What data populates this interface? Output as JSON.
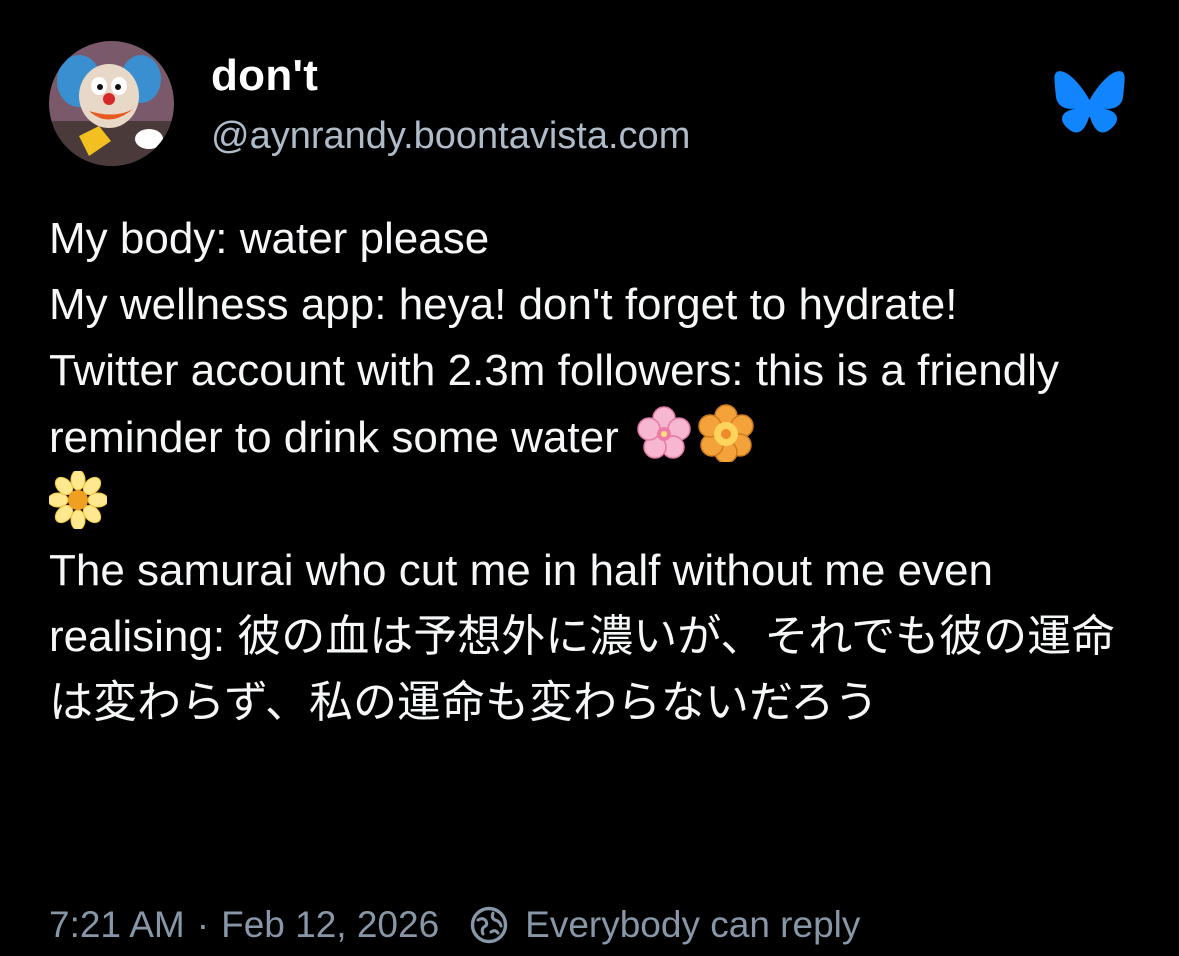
{
  "author": {
    "display_name": "don't",
    "handle": "@aynrandy.boontavista.com",
    "avatar_icon": "clown-avatar"
  },
  "brand": {
    "icon": "bluesky-butterfly-icon",
    "color": "#1185fe"
  },
  "post": {
    "lines": [
      "My body: water please",
      "My wellness app: heya! don't forget to hydrate!",
      "Twitter account with 2.3m followers: this is a friendly reminder to drink some water",
      "The samurai who cut me in half without me even realising: 彼の血は予想外に濃いが、それでも彼の運命は変わらず、私の運命も変わらないだろう"
    ],
    "emojis": [
      "cherry-blossom-icon",
      "rosette-flower-icon",
      "daisy-icon"
    ]
  },
  "footer": {
    "time": "7:21 AM",
    "separator": "·",
    "date": "Feb 12, 2026",
    "reply_icon": "globe-reply-icon",
    "reply_setting": "Everybody can reply"
  },
  "colors": {
    "background": "#000000",
    "text": "#f5f7f9",
    "handle": "#aebbc9",
    "meta": "#8797a8"
  }
}
